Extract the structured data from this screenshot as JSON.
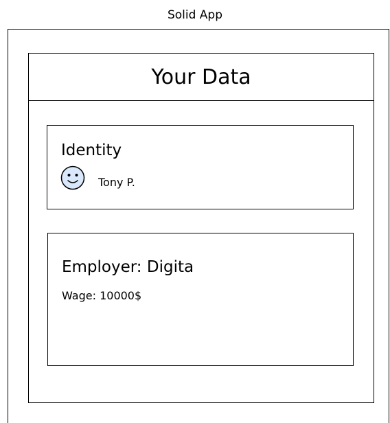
{
  "app": {
    "title": "Solid App"
  },
  "panel": {
    "title": "Your Data"
  },
  "identity": {
    "heading": "Identity",
    "avatar_icon": "smiley-face-icon",
    "user_name": "Tony P."
  },
  "employer": {
    "heading": "Employer: Digita",
    "wage": "Wage: 10000$"
  },
  "colors": {
    "avatar_fill": "#dae8fc",
    "avatar_stroke": "#000000",
    "line": "#000000",
    "background": "#ffffff"
  }
}
